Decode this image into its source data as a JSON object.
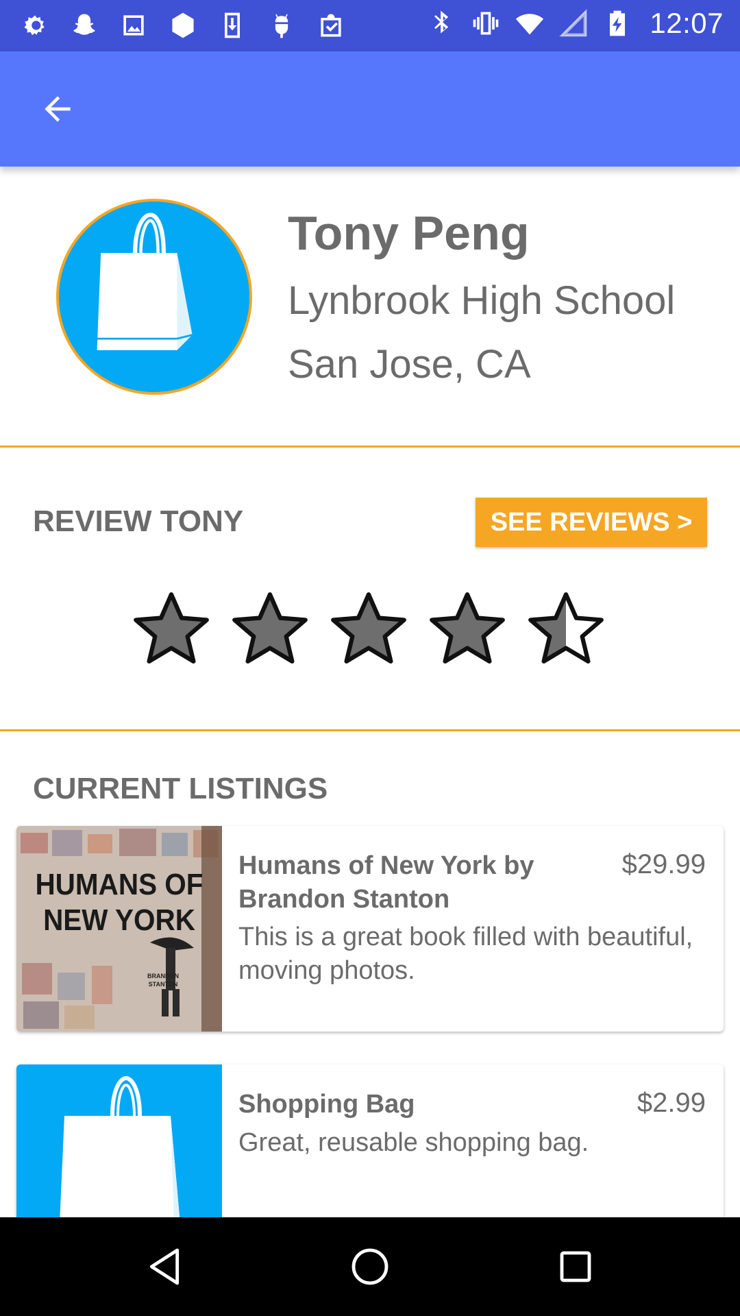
{
  "status_bar": {
    "time": "12:07",
    "left_icons": [
      "brightness-icon",
      "snapchat-icon",
      "image-icon",
      "hexagon-icon",
      "download-icon",
      "android-icon",
      "clipboard-check-icon"
    ],
    "right_icons": [
      "bluetooth-icon",
      "vibrate-icon",
      "wifi-icon",
      "signal-icon",
      "battery-charging-icon"
    ]
  },
  "app_bar": {
    "color": "#5677fc",
    "back_icon": "arrow-back-icon"
  },
  "profile": {
    "name": "Tony Peng",
    "school": "Lynbrook High School",
    "location": "San Jose, CA",
    "avatar_icon": "shopping-bag-icon",
    "avatar_bg": "#03a9f4",
    "avatar_border": "#f5a623"
  },
  "review": {
    "heading": "REVIEW TONY",
    "see_reviews_label": "SEE REVIEWS >",
    "rating": 4.5,
    "max_rating": 5
  },
  "listings": {
    "heading": "CURRENT LISTINGS",
    "items": [
      {
        "title": "Humans of New York by Brandon Stanton",
        "price": "$29.99",
        "description": "This is a great book filled with beautiful, moving photos.",
        "cover_title_line1": "HUMANS OF",
        "cover_title_line2": "NEW YORK",
        "cover_author_line1": "BRANDON",
        "cover_author_line2": "STANTON"
      },
      {
        "title": "Shopping Bag",
        "price": "$2.99",
        "description": "Great, reusable shopping bag.",
        "thumb_icon": "shopping-bag-icon"
      }
    ]
  },
  "nav_bar": {
    "back_icon": "triangle-back-icon",
    "home_icon": "circle-home-icon",
    "recents_icon": "square-recents-icon"
  },
  "colors": {
    "accent": "#f5a623",
    "primary": "#5677fc",
    "status_bar": "#3f51d4",
    "text": "#6b6b6b",
    "star_fill": "#6e6e6e"
  }
}
